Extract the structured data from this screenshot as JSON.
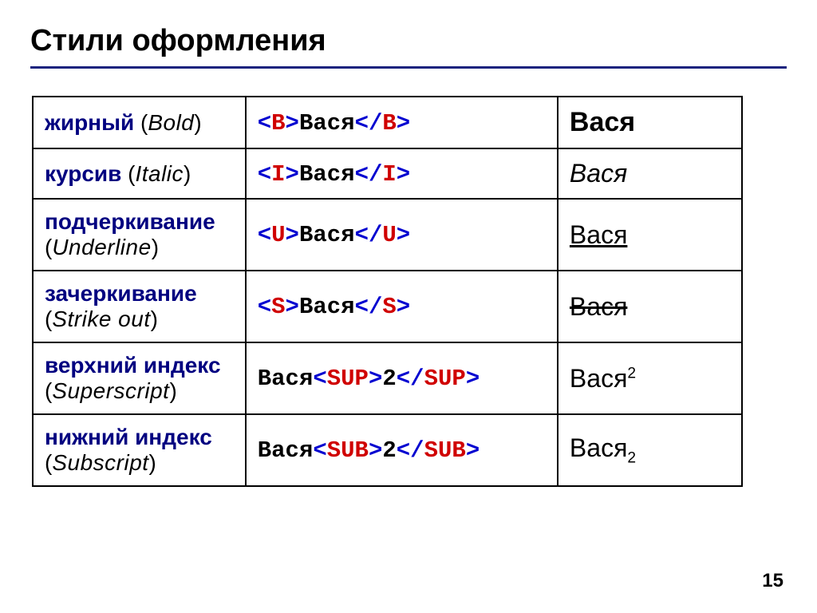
{
  "title": "Стили оформления",
  "page_number": "15",
  "sample_text": "Вася",
  "sample_num": "2",
  "rows": [
    {
      "name": "жирный",
      "en": "Bold",
      "tag": "B",
      "render": "bold",
      "inline": false
    },
    {
      "name": "курсив",
      "en": "Italic",
      "tag": "I",
      "render": "italic",
      "inline": false
    },
    {
      "name": "подчеркивание",
      "en": "Underline",
      "tag": "U",
      "render": "under",
      "inline": false
    },
    {
      "name": "зачеркивание",
      "en": "Strike out",
      "tag": "S",
      "render": "strike",
      "inline": false
    },
    {
      "name": "верхний индекс",
      "en": "Superscript",
      "tag": "SUP",
      "render": "sup",
      "inline": true
    },
    {
      "name": "нижний индекс",
      "en": "Subscript",
      "tag": "SUB",
      "render": "sub",
      "inline": true
    }
  ]
}
